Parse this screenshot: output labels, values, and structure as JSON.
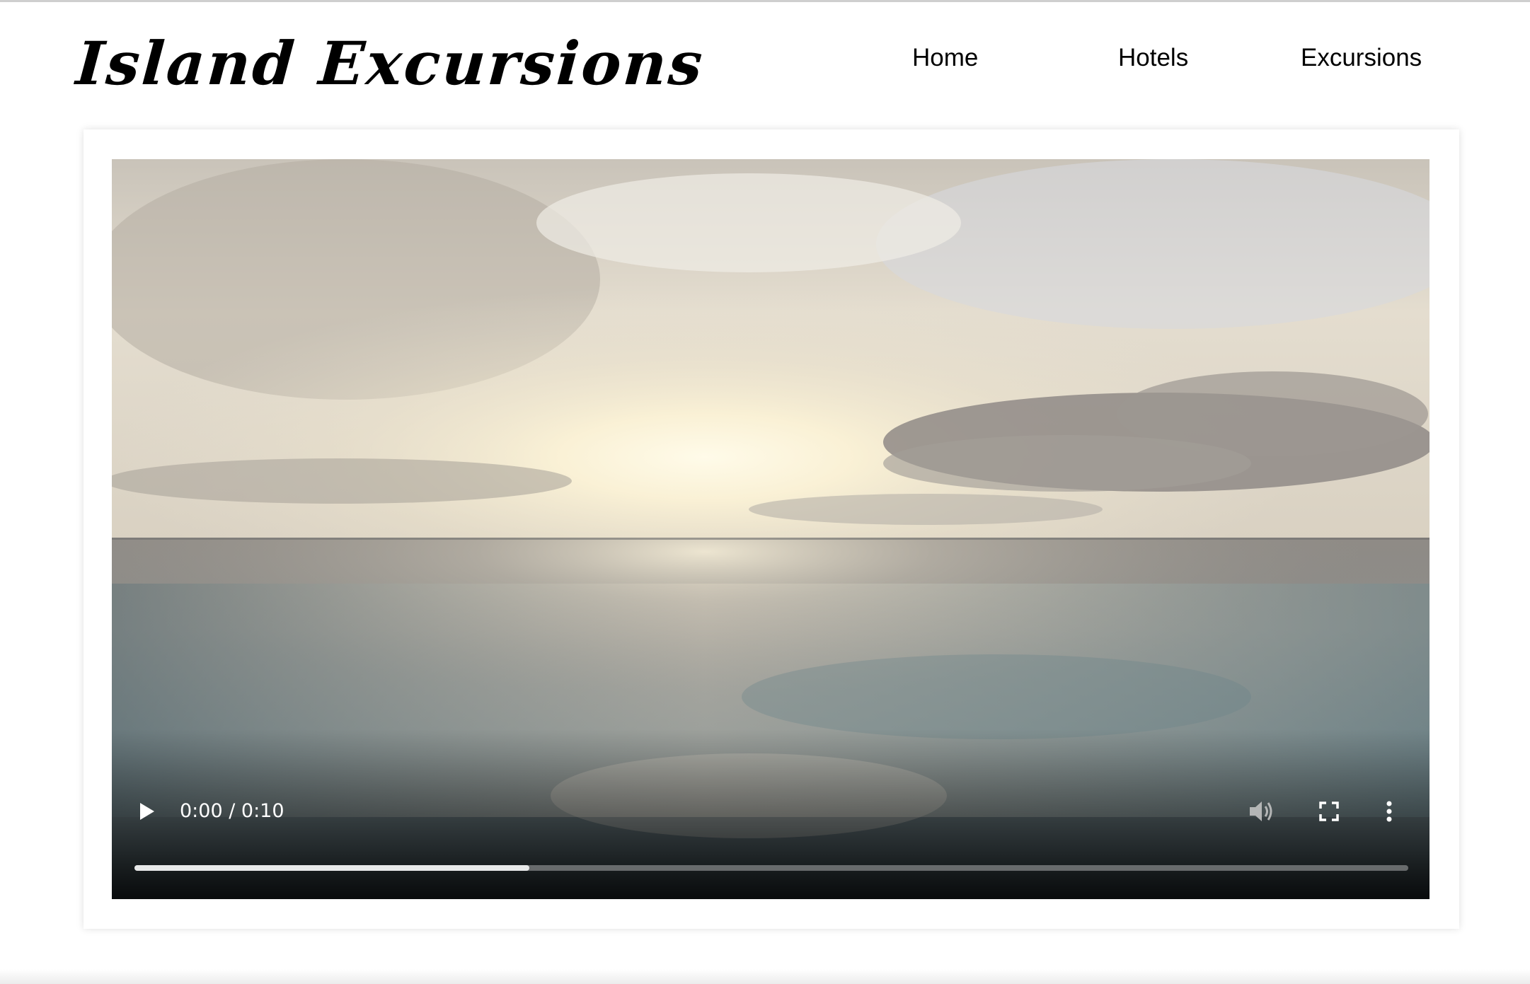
{
  "header": {
    "brand_title": "Island Excursions",
    "nav": [
      {
        "label": "Home"
      },
      {
        "label": "Hotels"
      },
      {
        "label": "Excursions"
      }
    ]
  },
  "video": {
    "time_display": "0:00 / 0:10",
    "buffered_fraction": 0.31,
    "icons": [
      "play-icon",
      "volume-icon",
      "fullscreen-icon",
      "more-options-icon"
    ]
  }
}
